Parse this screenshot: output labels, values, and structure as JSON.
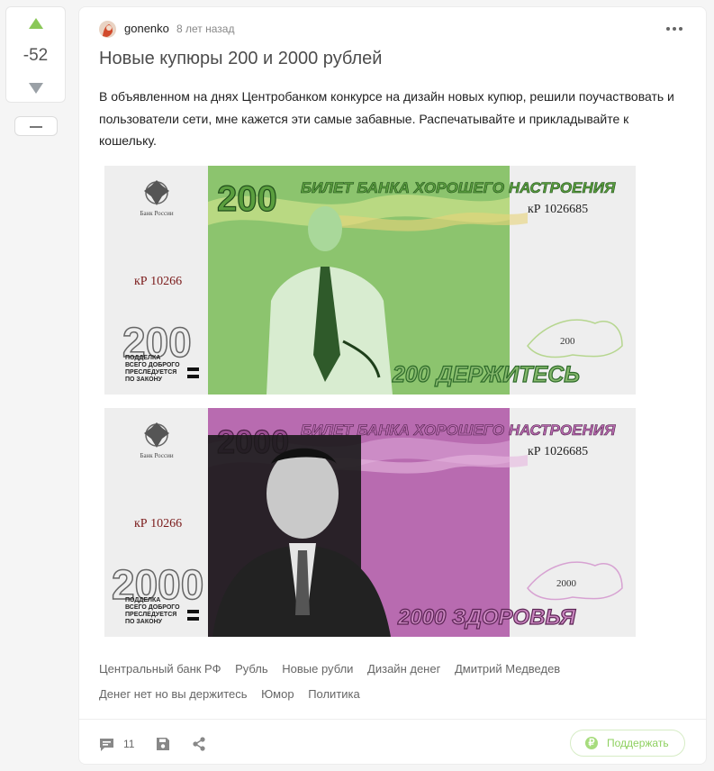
{
  "rating": {
    "score": "-52"
  },
  "post": {
    "author": "gonenko",
    "time": "8 лет назад",
    "title": "Новые купюры 200 и 2000 рублей",
    "text": "В объявленном на днях Центробанком конкурсе на дизайн новых купюр, решили поучаствовать и пользователи сети, мне кажется эти самые забавные. Распечатывайте и прикладывайте к кошельку."
  },
  "note1": {
    "denomination": "200",
    "header": "БИЛЕТ БАНКА ХОРОШЕГО НАСТРОЕНИЯ",
    "serial": "кР  1026685",
    "serial_left": "кР  10266",
    "bank_label": "Банк России",
    "legal": "ПОДДЕЛКА\nВСЕГО ДОБРОГО\nПРЕСЛЕДУЕТСЯ\nПО ЗАКОНУ",
    "watermark_value": "200",
    "slogan": "200 ДЕРЖИТЕСЬ",
    "colors": {
      "field": "#8cc46e",
      "text": "#5a9e3e",
      "slogan_fill": "#86b86d",
      "slogan_stroke": "#2e6b2a"
    }
  },
  "note2": {
    "denomination": "2000",
    "header": "БИЛЕТ БАНКА ХОРОШЕГО НАСТРОЕНИЯ",
    "serial": "кР  1026685",
    "serial_left": "кР  10266",
    "bank_label": "Банк России",
    "legal": "ПОДДЕЛКА\nВСЕГО ДОБРОГО\nПРЕСЛЕДУЕТСЯ\nПО ЗАКОНУ",
    "watermark_value": "2000",
    "slogan": "2000 ЗДОРОВЬЯ",
    "colors": {
      "field": "#b86bb0",
      "text": "#9d4f95",
      "slogan_fill": "#c987bf",
      "slogan_stroke": "#5c2455"
    }
  },
  "tags": [
    "Центральный банк РФ",
    "Рубль",
    "Новые рубли",
    "Дизайн денег",
    "Дмитрий Медведев",
    "Денег нет но вы держитесь",
    "Юмор",
    "Политика"
  ],
  "footer": {
    "comments_count": "11",
    "support_label": "Поддержать",
    "accent": "#8ed05f"
  }
}
